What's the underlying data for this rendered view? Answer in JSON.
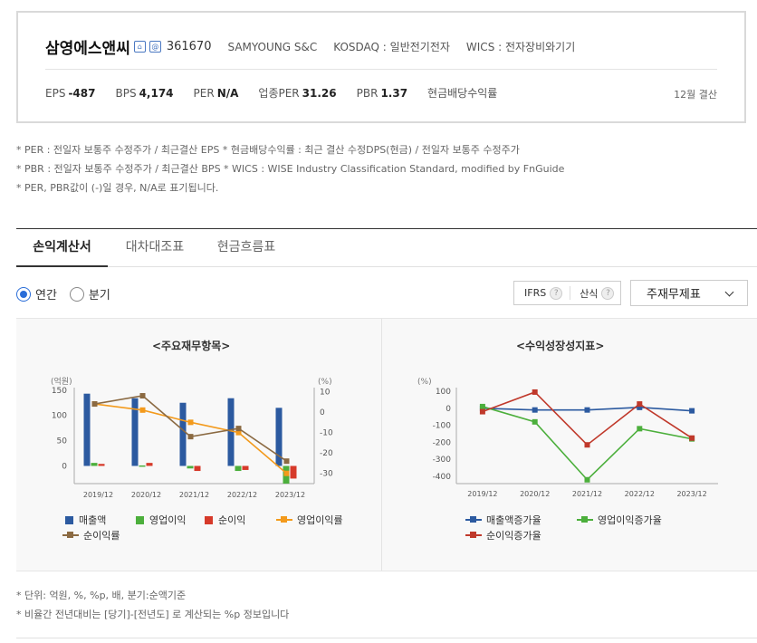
{
  "header": {
    "company_name": "삼영에스앤씨",
    "icons": [
      "home-icon",
      "mail-icon"
    ],
    "stock_code": "361670",
    "english_name": "SAMYOUNG S&C",
    "market": "KOSDAQ : 일반전기전자",
    "wics": "WICS : 전자장비와기기",
    "metrics": [
      {
        "label": "EPS",
        "value": "-487"
      },
      {
        "label": "BPS",
        "value": "4,174"
      },
      {
        "label": "PER",
        "value": "N/A"
      },
      {
        "label": "업종PER",
        "value": "31.26"
      },
      {
        "label": "PBR",
        "value": "1.37"
      },
      {
        "label": "현금배당수익률",
        "value": ""
      }
    ],
    "fiscal": "12월 결산"
  },
  "notes": [
    "* PER : 전일자 보통주 수정주가 / 최근결산 EPS * 현금배당수익률 : 최근 결산 수정DPS(현금) / 전일자 보통주 수정주가",
    "* PBR : 전일자 보통주 수정주가 / 최근결산 BPS * WICS : WISE Industry Classification Standard, modified by FnGuide",
    "* PER, PBR값이 (-)일 경우, N/A로 표기됩니다."
  ],
  "tabs": [
    {
      "label": "손익계산서",
      "active": true
    },
    {
      "label": "대차대조표",
      "active": false
    },
    {
      "label": "현금흐름표",
      "active": false
    }
  ],
  "period": {
    "options": [
      {
        "label": "연간",
        "selected": true
      },
      {
        "label": "분기",
        "selected": false
      }
    ]
  },
  "options": {
    "ifrs": "IFRS",
    "calc": "산식",
    "help": "?",
    "dropdown_value": "주재무제표"
  },
  "colors": {
    "sales": "#2c5aa0",
    "op_income": "#4caf3c",
    "net_income": "#d63a2a",
    "op_margin": "#f39a1c",
    "net_margin": "#8b6a42",
    "growth_sales": "#2c5aa0",
    "growth_op": "#4caf3c",
    "growth_net": "#c0392b"
  },
  "chart_data": [
    {
      "type": "bar",
      "title": "<주요재무항목>",
      "categories": [
        "2019/12",
        "2020/12",
        "2021/12",
        "2022/12",
        "2023/12"
      ],
      "ylabel": "(억원)",
      "y2label": "(%)",
      "ylim": [
        -35,
        155
      ],
      "yticks": [
        0,
        50,
        100,
        150
      ],
      "y2lim": [
        -35,
        12
      ],
      "y2ticks": [
        10,
        0,
        -10,
        -20,
        -30
      ],
      "series": [
        {
          "name": "매출액",
          "kind": "bar",
          "axis": "left",
          "values": [
            143,
            134,
            125,
            134,
            115
          ]
        },
        {
          "name": "영업이익",
          "kind": "bar",
          "axis": "left",
          "values": [
            6,
            1,
            -5,
            -10,
            -35
          ]
        },
        {
          "name": "순이익",
          "kind": "bar",
          "axis": "left",
          "values": [
            4,
            6,
            -10,
            -8,
            -25
          ]
        },
        {
          "name": "영업이익률",
          "kind": "line",
          "axis": "right",
          "values": [
            4,
            1,
            -5,
            -10,
            -30
          ]
        },
        {
          "name": "순이익률",
          "kind": "line",
          "axis": "right",
          "values": [
            4,
            8,
            -12,
            -8,
            -24
          ]
        }
      ]
    },
    {
      "type": "line",
      "title": "<수익성장성지표>",
      "categories": [
        "2019/12",
        "2020/12",
        "2021/12",
        "2022/12",
        "2023/12"
      ],
      "ylabel": "(%)",
      "ylim": [
        -400,
        100
      ],
      "yticks": [
        100,
        0,
        -100,
        -200,
        -300,
        -400
      ],
      "series": [
        {
          "name": "매출액증가율",
          "values": [
            0,
            -10,
            -10,
            5,
            -15
          ]
        },
        {
          "name": "영업이익증가율",
          "values": [
            10,
            -80,
            -420,
            -120,
            -180
          ]
        },
        {
          "name": "순이익증가율",
          "values": [
            -20,
            95,
            -215,
            25,
            -175
          ]
        }
      ]
    }
  ],
  "footer_notes": [
    "* 단위: 억원, %, %p, 배, 분기:순액기준",
    "* 비율간 전년대비는 [당기]-[전년도] 로 계산되는 %p 정보입니다"
  ]
}
